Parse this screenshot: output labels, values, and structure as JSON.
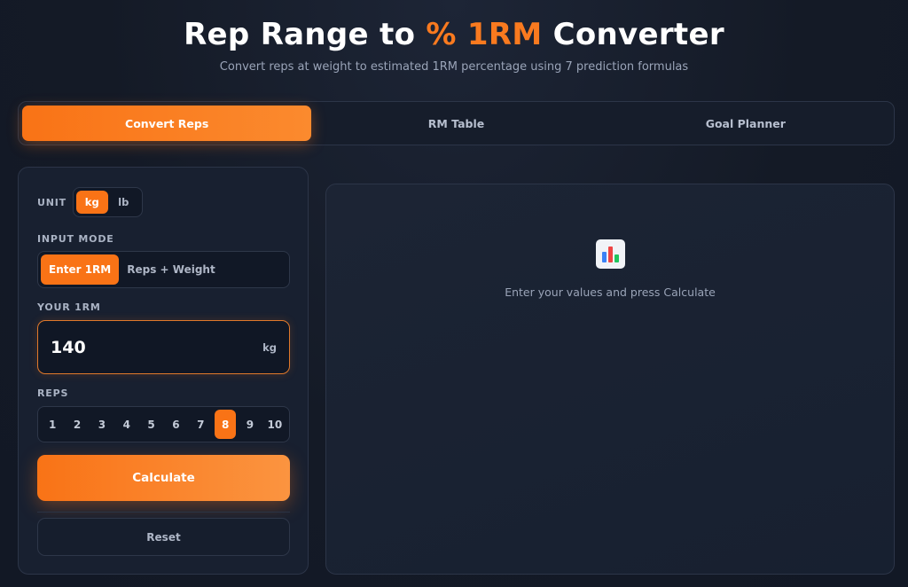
{
  "header": {
    "title_prefix": "Rep Range to ",
    "title_accent": "% 1RM",
    "title_suffix": " Converter",
    "subtitle": "Convert reps at weight to estimated 1RM percentage using 7 prediction formulas"
  },
  "tabs": [
    {
      "label": "Convert Reps",
      "active": true
    },
    {
      "label": "RM Table",
      "active": false
    },
    {
      "label": "Goal Planner",
      "active": false
    }
  ],
  "form": {
    "unit_label": "UNIT",
    "units": [
      {
        "label": "kg",
        "active": true
      },
      {
        "label": "lb",
        "active": false
      }
    ],
    "input_mode_label": "INPUT MODE",
    "modes": [
      {
        "label": "Enter 1RM",
        "active": true
      },
      {
        "label": "Reps + Weight",
        "active": false
      }
    ],
    "your_1rm_label": "YOUR 1RM",
    "one_rm_value": "140",
    "one_rm_unit": "kg",
    "reps_label": "REPS",
    "reps": [
      "1",
      "2",
      "3",
      "4",
      "5",
      "6",
      "7",
      "8",
      "9",
      "10"
    ],
    "selected_rep": "8",
    "calculate_label": "Calculate",
    "reset_label": "Reset"
  },
  "results": {
    "icon": "bar-chart-icon",
    "empty_message": "Enter your values and press Calculate"
  },
  "colors": {
    "accent": "#f97316",
    "background": "#141a26",
    "panel": "#182030"
  }
}
